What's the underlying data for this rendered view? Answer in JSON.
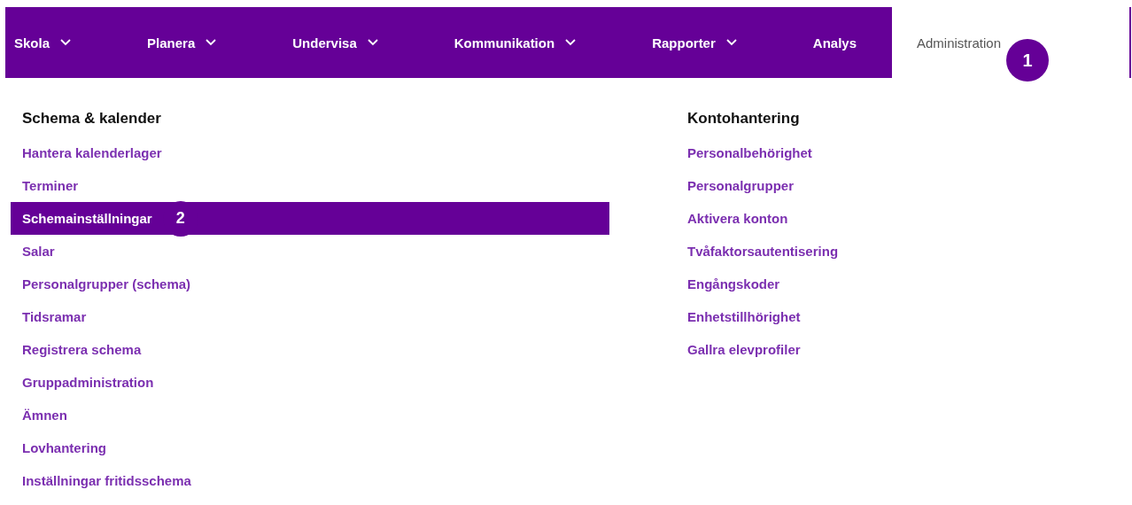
{
  "nav": [
    {
      "label": "Skola",
      "dropdown": true,
      "selected": false
    },
    {
      "label": "Planera",
      "dropdown": true,
      "selected": false
    },
    {
      "label": "Undervisa",
      "dropdown": true,
      "selected": false
    },
    {
      "label": "Kommunikation",
      "dropdown": true,
      "selected": false
    },
    {
      "label": "Rapporter",
      "dropdown": true,
      "selected": false
    },
    {
      "label": "Analys",
      "dropdown": false,
      "selected": false
    },
    {
      "label": "Administration",
      "dropdown": false,
      "selected": true,
      "callout": "1"
    }
  ],
  "sections": [
    {
      "title": "Schema & kalender",
      "items": [
        {
          "label": "Hantera kalenderlager",
          "selected": false
        },
        {
          "label": "Terminer",
          "selected": false
        },
        {
          "label": "Schemainställningar",
          "selected": true,
          "callout": "2"
        },
        {
          "label": "Salar",
          "selected": false
        },
        {
          "label": "Personalgrupper (schema)",
          "selected": false
        },
        {
          "label": "Tidsramar",
          "selected": false
        },
        {
          "label": "Registrera schema",
          "selected": false
        },
        {
          "label": "Gruppadministration",
          "selected": false
        },
        {
          "label": "Ämnen",
          "selected": false
        },
        {
          "label": "Lovhantering",
          "selected": false
        },
        {
          "label": "Inställningar fritidsschema",
          "selected": false
        }
      ]
    },
    {
      "title": "Kontohantering",
      "items": [
        {
          "label": "Personalbehörighet",
          "selected": false
        },
        {
          "label": "Personalgrupper",
          "selected": false
        },
        {
          "label": "Aktivera konton",
          "selected": false
        },
        {
          "label": "Tvåfaktorsautentisering",
          "selected": false
        },
        {
          "label": "Engångskoder",
          "selected": false
        },
        {
          "label": "Enhetstillhörighet",
          "selected": false
        },
        {
          "label": "Gallra elevprofiler",
          "selected": false
        }
      ]
    }
  ]
}
